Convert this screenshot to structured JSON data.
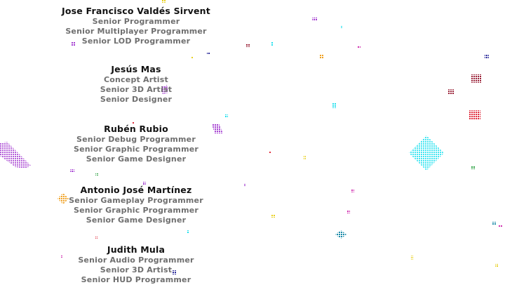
{
  "credits": [
    {
      "name": "Jose Francisco Valdés Sirvent",
      "roles": [
        "Senior Programmer",
        "Senior Multiplayer Programmer",
        "Senior LOD Programmer"
      ]
    },
    {
      "name": "Jesús Mas",
      "roles": [
        "Concept Artist",
        "Senior 3D Artist",
        "Senior Designer"
      ]
    },
    {
      "name": "Rubén Rubio",
      "roles": [
        "Senior Debug Programmer",
        "Senior Graphic Programmer",
        "Senior Game Designer"
      ]
    },
    {
      "name": "Antonio José Martínez",
      "roles": [
        "Senior Gameplay Programmer",
        "Senior Graphic Programmer",
        "Senior Game Designer"
      ]
    },
    {
      "name": "Judith Mula",
      "roles": [
        "Senior Audio Programmer",
        "Senior 3D Artist",
        "Senior HUD Programmer"
      ]
    }
  ],
  "particle_colors": {
    "cyan": "#22e0ee",
    "purple": "#a23ad0",
    "orange": "#f0a020",
    "red": "#e02c3c",
    "maroon": "#9a2238",
    "teal": "#1a8aa8",
    "green": "#2aa040",
    "yellow": "#e8d020",
    "navy": "#2a2a9a",
    "magenta": "#d030b0"
  }
}
